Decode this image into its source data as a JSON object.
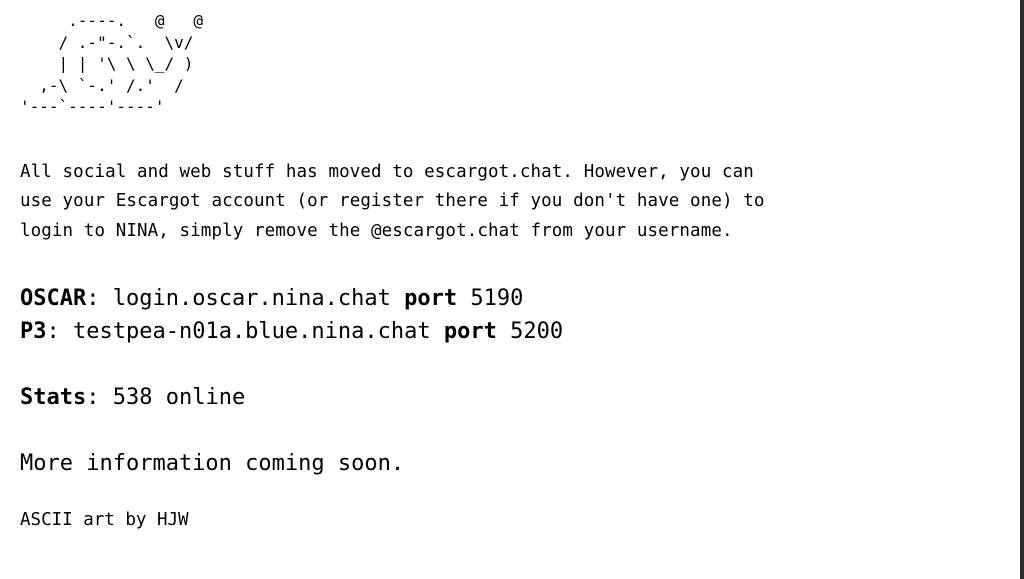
{
  "ascii_art": "     .----.   @   @\n    / .-\"-.`.  \\v/\n    | | '\\ \\ \\_/ )\n  ,-\\ `-.' /.'  /\n'---`----'----'",
  "intro": {
    "lines": [
      "All social and web stuff has moved to escargot.chat. However, you can",
      "use your Escargot account (or register there if you don't have one) to",
      "login to NINA, simply remove the @escargot.chat from your username."
    ]
  },
  "servers": {
    "oscar": {
      "label": "OSCAR",
      "separator": ": ",
      "host": "login.oscar.nina.chat",
      "port_word": "port",
      "port": "5190"
    },
    "p3": {
      "label": "P3",
      "separator": ": ",
      "host": "testpea-n01a.blue.nina.chat",
      "port_word": "port",
      "port": "5200"
    }
  },
  "stats": {
    "label": "Stats",
    "separator": ": ",
    "value": "538 online"
  },
  "more_info": "More information coming soon.",
  "credit": "ASCII art by HJW"
}
